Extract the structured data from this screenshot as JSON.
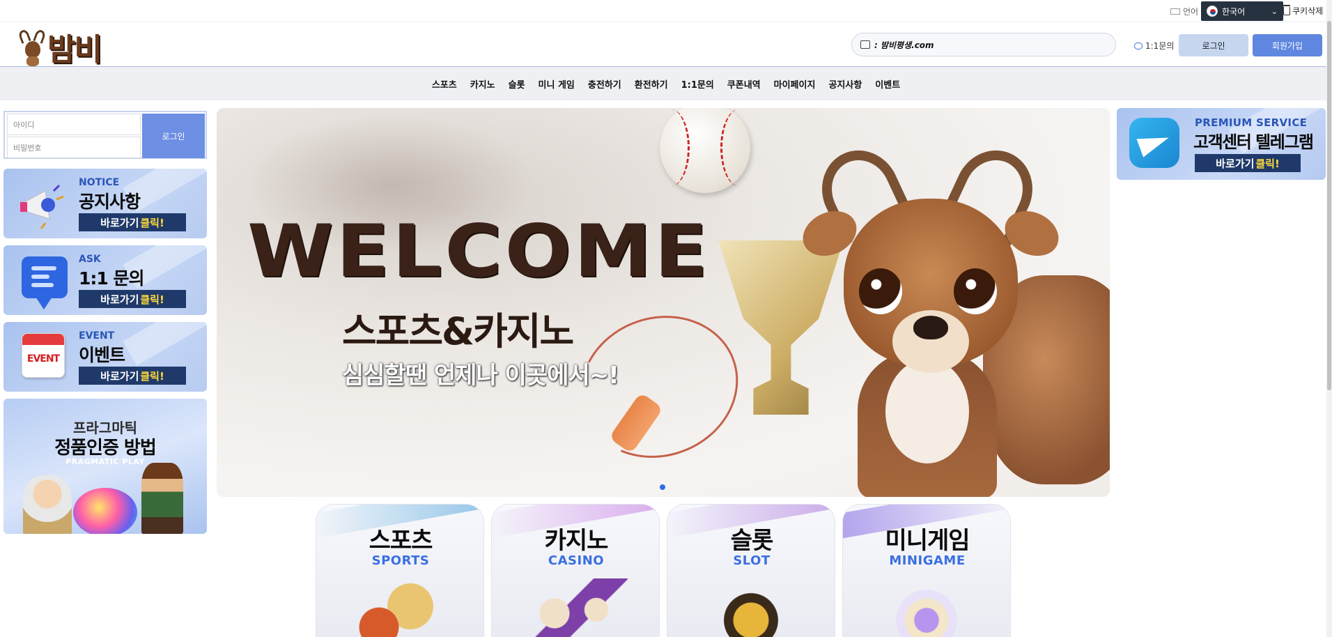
{
  "topbar": {
    "lang_label": "언어",
    "lang_selected": "한국어",
    "cookie_delete": "쿠키삭제"
  },
  "header": {
    "logo_text": "밤비",
    "notice_text": ": 밤비평생.com",
    "qna_label": "1:1문의",
    "login_label": "로그인",
    "signup_label": "회원가입"
  },
  "nav": {
    "items": [
      "스포츠",
      "카지노",
      "슬롯",
      "미니 게임",
      "충전하기",
      "환전하기",
      "1:1문의",
      "쿠폰내역",
      "마이페이지",
      "공지사항",
      "이벤트"
    ]
  },
  "login_form": {
    "id_placeholder": "아이디",
    "pw_placeholder": "비밀번호",
    "submit_label": "로그인"
  },
  "side_cards": [
    {
      "en": "NOTICE",
      "ko": "공지사항",
      "go": "바로가기",
      "go_hl": "클릭!"
    },
    {
      "en": "ASK",
      "ko": "1:1 문의",
      "go": "바로가기",
      "go_hl": "클릭!"
    },
    {
      "en": "EVENT",
      "ko": "이벤트",
      "go": "바로가기",
      "go_hl": "클릭!",
      "icon_text": "EVENT"
    }
  ],
  "pragmatic": {
    "line1": "프라그마틱",
    "line2": "정품인증 방법",
    "line3": "PRAGMATIC PLAY"
  },
  "banner": {
    "welcome": "WELCOME",
    "title": "스포츠&카지노",
    "subtitle": "심심할땐 언제나 이곳에서~!"
  },
  "telegram": {
    "en": "PREMIUM SERVICE",
    "ko": "고객센터 텔레그램",
    "go": "바로가기",
    "go_hl": "클릭!"
  },
  "categories": [
    {
      "ko": "스포츠",
      "en": "SPORTS",
      "ribbon": "#8fc3e8"
    },
    {
      "ko": "카지노",
      "en": "CASINO",
      "ribbon": "#d7a8ec"
    },
    {
      "ko": "슬롯",
      "en": "SLOT",
      "ribbon": "#c7a6e8"
    },
    {
      "ko": "미니게임",
      "en": "MINIGAME",
      "ribbon": "#b3a2ec"
    }
  ],
  "colors": {
    "primary": "#5f87e0",
    "secondary": "#c6d6ef",
    "dark_button": "#1f3a6a",
    "highlight": "#ffd83a"
  }
}
